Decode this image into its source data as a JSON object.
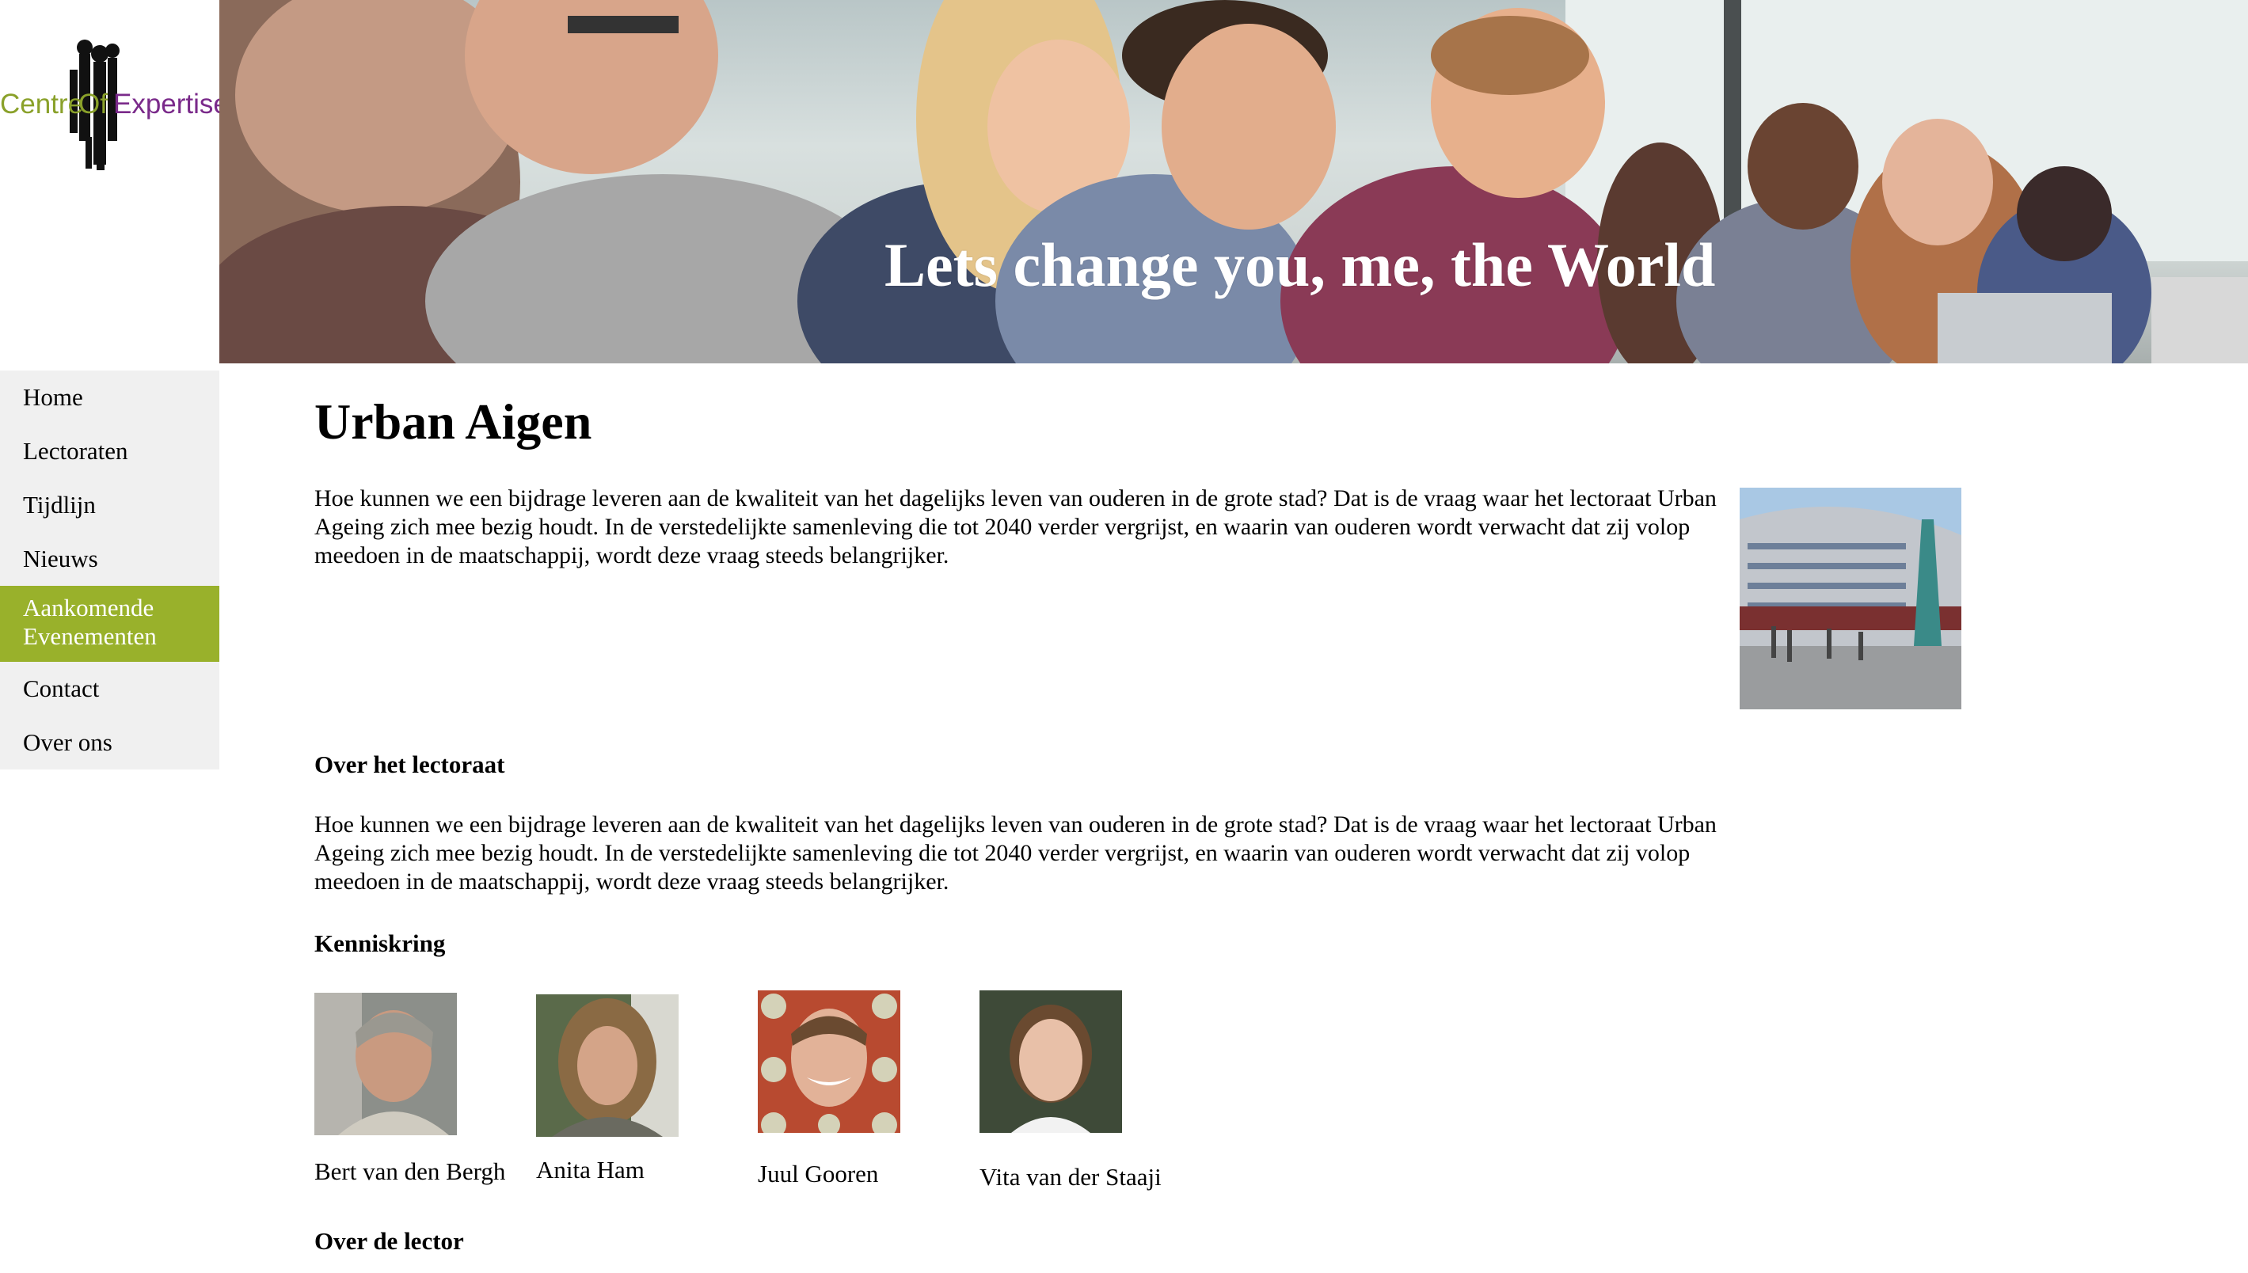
{
  "logo": {
    "word1": "Centre",
    "word2": "Of",
    "word3": "Expertise"
  },
  "banner": {
    "title": "Lets change you, me, the World"
  },
  "nav": {
    "items": [
      {
        "label": "Home"
      },
      {
        "label": "Lectoraten"
      },
      {
        "label": "Tijdlijn"
      },
      {
        "label": "Nieuws"
      },
      {
        "label": "Aankomende\nEvenementen",
        "label_line1": "Aankomende",
        "label_line2": "Evenementen"
      },
      {
        "label": "Contact"
      },
      {
        "label": "Over ons"
      }
    ],
    "active_index": 4
  },
  "main": {
    "title": "Urban Aigen",
    "intro": "Hoe kunnen we een bijdrage leveren aan de kwaliteit van het dagelijks leven van ouderen in de grote stad? Dat is de vraag waar het lectoraat Urban Ageing zich mee bezig houdt. In de verstedelijkte samenleving die tot 2040 verder vergrijst, en waarin van ouderen wordt verwacht dat zij volop meedoen in de maatschappij, wordt deze vraag steeds belangrijker.",
    "section_lectoraat": "Over het lectoraat",
    "lectoraat_text": "Hoe kunnen we een bijdrage leveren aan de kwaliteit van het dagelijks leven van ouderen in de grote stad? Dat is de vraag waar het lectoraat Urban Ageing zich mee bezig houdt. In de verstedelijkte samenleving die tot 2040 verder vergrijst, en waarin van ouderen wordt verwacht dat zij volop meedoen in de maatschappij, wordt deze vraag steeds belangrijker.",
    "section_kenniskring": "Kenniskring",
    "members": [
      {
        "name": "Bert van den Bergh"
      },
      {
        "name": "Anita Ham"
      },
      {
        "name": "Juul Gooren"
      },
      {
        "name": "Vita van der Staaji"
      }
    ],
    "section_lector": "Over de lector"
  },
  "colors": {
    "accent": "#99b12b",
    "nav_bg": "#f0f0f0",
    "logo_green": "#8aa12a",
    "logo_purple": "#7a2a8a"
  }
}
